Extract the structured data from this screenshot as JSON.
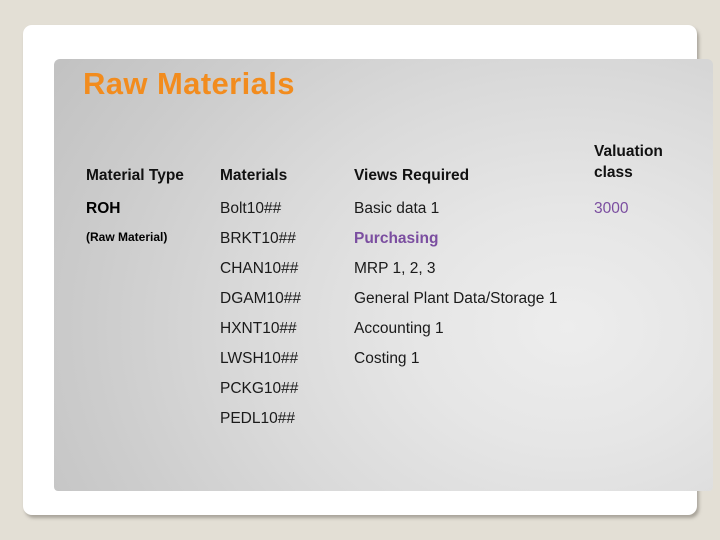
{
  "slide": {
    "title": "Raw Materials",
    "title_color": "#f28c1e",
    "accent_purple": "#7b4ea0",
    "panel_bg_light": "#ededed",
    "panel_bg_dark": "#b9b9b9",
    "page_bg": "#e3dfd5"
  },
  "table": {
    "headers": {
      "material_type": "Material Type",
      "materials": "Materials",
      "views_required": "Views Required",
      "valuation_class_line1": "Valuation",
      "valuation_class_line2": "class"
    },
    "material_type": {
      "code": "ROH",
      "description": "(Raw Material)"
    },
    "materials": [
      "Bolt10##",
      "BRKT10##",
      "CHAN10##",
      "DGAM10##",
      "HXNT10##",
      "LWSH10##",
      "PCKG10##",
      "PEDL10##"
    ],
    "views_required": [
      {
        "label": "Basic data 1",
        "highlight": false
      },
      {
        "label": "Purchasing",
        "highlight": true
      },
      {
        "label": "MRP 1, 2, 3",
        "highlight": false
      },
      {
        "label": "General Plant Data/Storage 1",
        "highlight": false
      },
      {
        "label": "Accounting 1",
        "highlight": false
      },
      {
        "label": "Costing 1",
        "highlight": false
      }
    ],
    "valuation_class": "3000"
  }
}
